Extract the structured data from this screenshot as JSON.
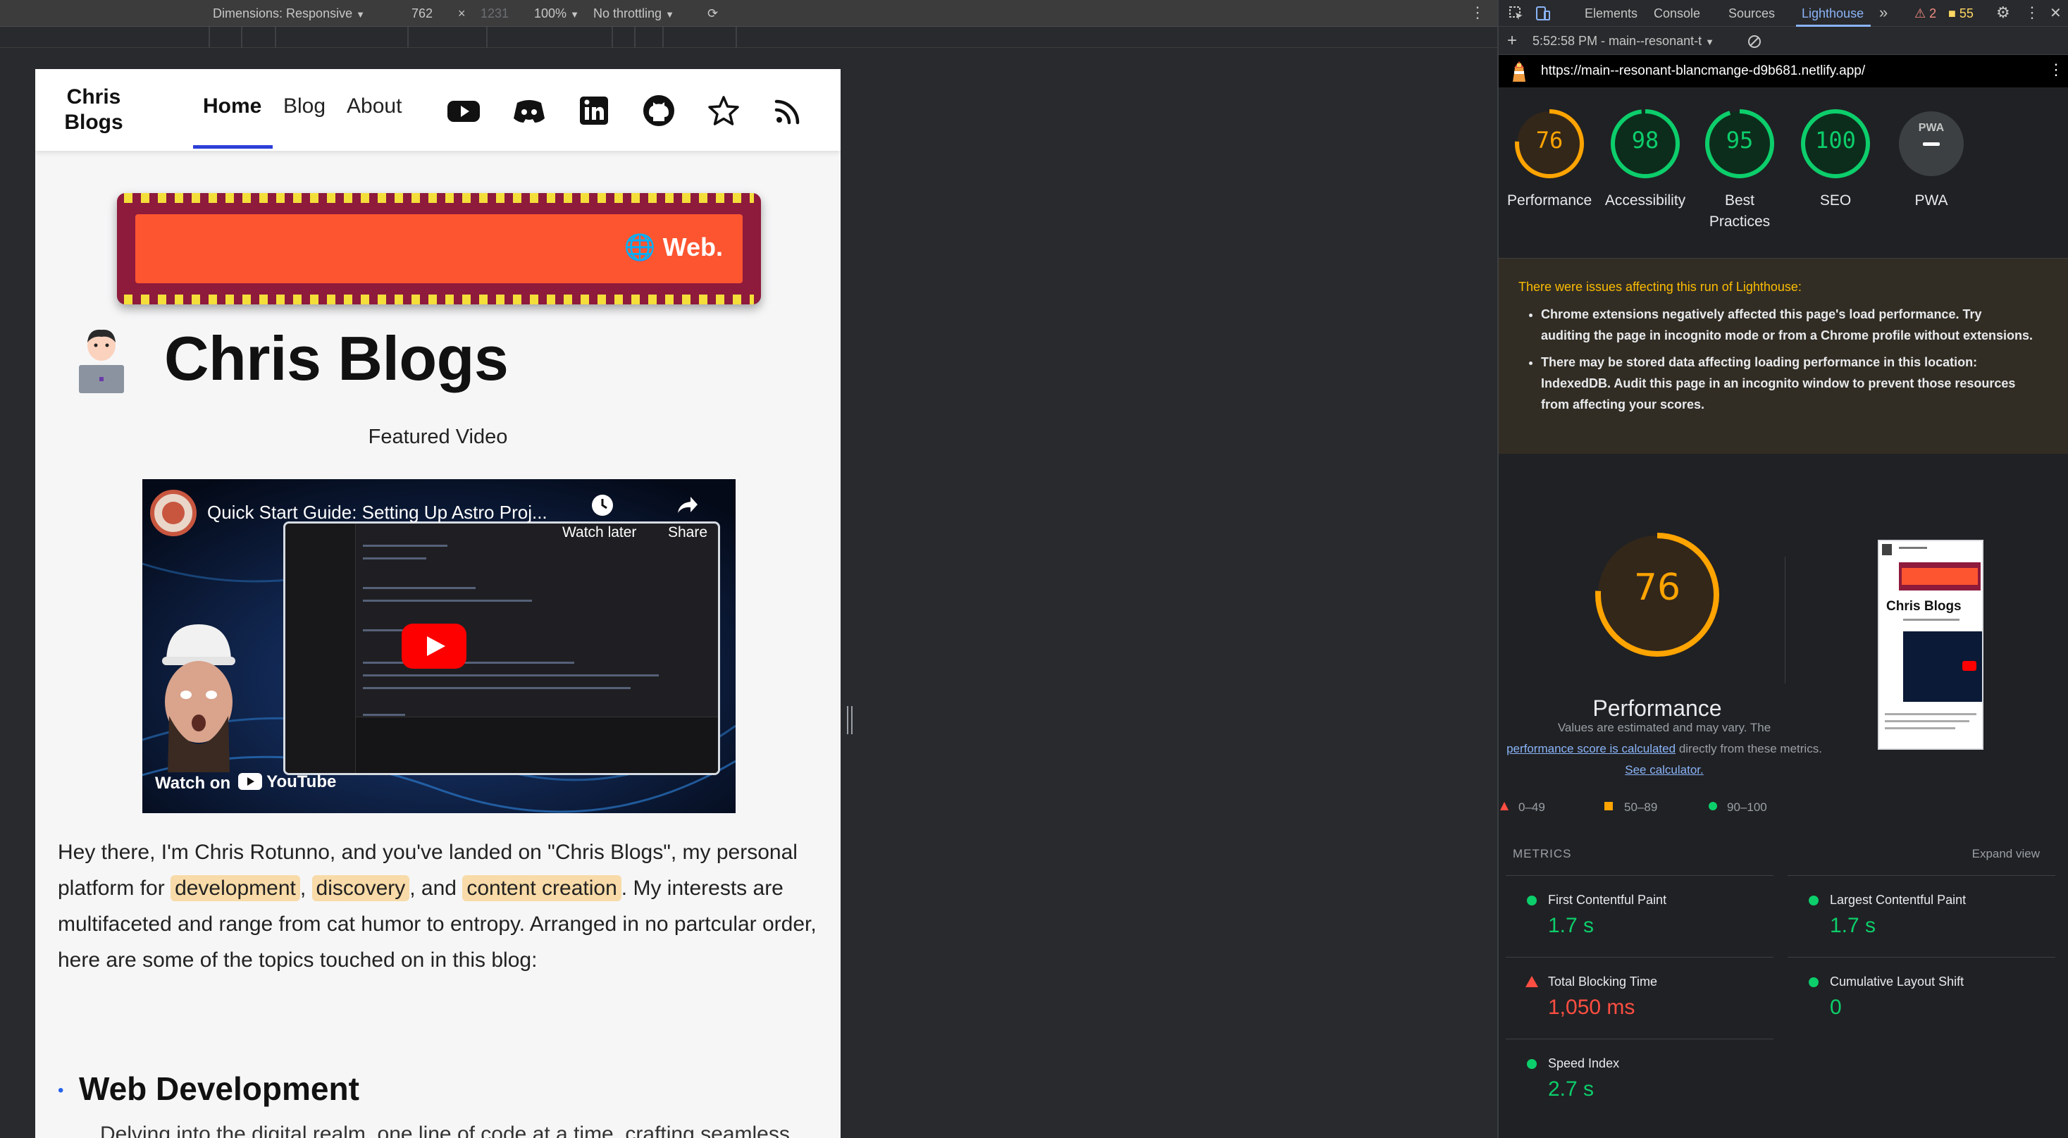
{
  "device_toolbar": {
    "dimensions_label": "Dimensions: Responsive",
    "width": "762",
    "times": "×",
    "height": "1231",
    "zoom": "100%",
    "throttling": "No throttling"
  },
  "site": {
    "title": "Chris Blogs",
    "nav": {
      "home": "Home",
      "blog": "Blog",
      "about": "About"
    },
    "banner_text": "🌐 Web.",
    "hero_title": "Chris Blogs",
    "featured_label": "Featured Video",
    "video": {
      "title": "Quick Start Guide: Setting Up Astro Proj...",
      "watch_later": "Watch later",
      "share": "Share",
      "watch_on": "Watch on",
      "youtube": "YouTube"
    },
    "intro": {
      "p1": "Hey there, I'm Chris Rotunno, and you've landed on \"Chris Blogs\", my personal platform for ",
      "tag1": "development",
      "sep1": ", ",
      "tag2": "discovery",
      "sep2": ", and ",
      "tag3": "content creation",
      "p2": ". My interests are multifaceted and range from cat humor to entropy. Arranged in no partcular order, here are some of the topics touched on in this blog:"
    },
    "section": {
      "bullet": "•",
      "title": "Web Development",
      "desc": "Delving into the digital realm, one line of code at a time, crafting seamless experiences."
    }
  },
  "devtools": {
    "tabs": [
      "Elements",
      "Console",
      "Sources",
      "Lighthouse"
    ],
    "more_tabs": "»",
    "warnings_count": "2",
    "issues_count": "55",
    "report_time": "5:52:58 PM - main--resonant-t",
    "url": "https://main--resonant-blancmange-d9b681.netlify.app/",
    "scores": [
      {
        "label": "Performance",
        "value": 76,
        "color": "#ffa400"
      },
      {
        "label": "Accessibility",
        "value": 98,
        "color": "#0cce6b"
      },
      {
        "label": "Best Practices",
        "value": 95,
        "color": "#0cce6b"
      },
      {
        "label": "SEO",
        "value": 100,
        "color": "#0cce6b"
      },
      {
        "label": "PWA",
        "value": "PWA",
        "color": "#9aa0a6"
      }
    ],
    "warning_title": "There were issues affecting this run of Lighthouse:",
    "warnings": [
      "Chrome extensions negatively affected this page's load performance. Try auditing the page in incognito mode or from a Chrome profile without extensions.",
      "There may be stored data affecting loading performance in this location: IndexedDB. Audit this page in an incognito window to prevent those resources from affecting your scores."
    ],
    "performance": {
      "score": 76,
      "label": "Performance",
      "note_1": "Values are estimated and may vary. The",
      "note_link": "performance score is calculated",
      "note_2": "directly from these metrics.",
      "note_link2": "See calculator."
    },
    "legend": {
      "poor": "0–49",
      "average": "50–89",
      "good": "90–100"
    },
    "metrics_heading": "METRICS",
    "expand_view": "Expand view",
    "metrics": [
      {
        "name": "First Contentful Paint",
        "value": "1.7 s",
        "status": "good",
        "color": "#0cce6b"
      },
      {
        "name": "Largest Contentful Paint",
        "value": "1.7 s",
        "status": "good",
        "color": "#0cce6b"
      },
      {
        "name": "Total Blocking Time",
        "value": "1,050 ms",
        "status": "poor",
        "color": "#ff4e42"
      },
      {
        "name": "Cumulative Layout Shift",
        "value": "0",
        "status": "good",
        "color": "#0cce6b"
      },
      {
        "name": "Speed Index",
        "value": "2.7 s",
        "status": "good",
        "color": "#0cce6b"
      }
    ],
    "thumbnail": {
      "site_title": "Chris Blogs"
    }
  }
}
